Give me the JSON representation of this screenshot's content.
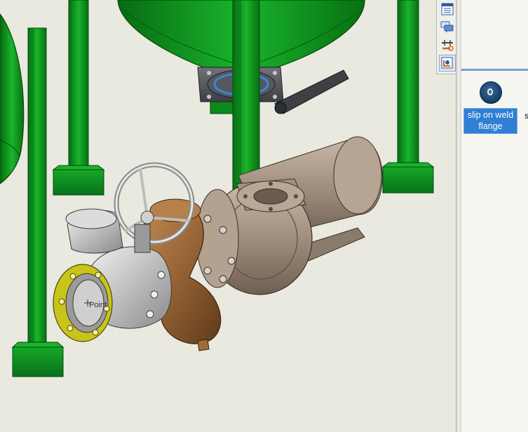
{
  "viewport": {
    "annotation_text": "Point"
  },
  "taskpane": {
    "tabs": [
      {
        "name": "properties-tab",
        "icon": "list-icon"
      },
      {
        "name": "forum-tab",
        "icon": "chat-bubbles-icon"
      },
      {
        "name": "design-library-tab",
        "icon": "pipe-library-icon"
      },
      {
        "name": "file-explorer-tab",
        "icon": "explorer-icon"
      }
    ],
    "active_tab": 3
  },
  "library": {
    "items": [
      {
        "label": "slip on weld flange",
        "icon": "flange-icon",
        "selected": true
      },
      {
        "label": "s"
      }
    ]
  },
  "colors": {
    "frame_green": "#0c8f1c",
    "valve_bronze": "#9a6a39",
    "pump_tan": "#a89584",
    "flange_yellow": "#d7d21e",
    "selection_blue": "#2f7fd4"
  }
}
